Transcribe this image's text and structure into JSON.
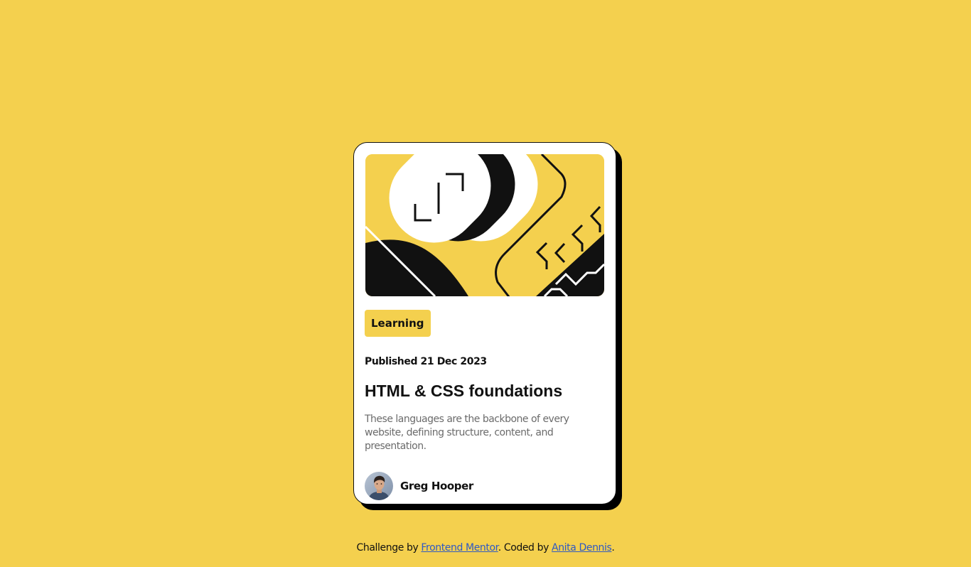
{
  "colors": {
    "background": "#F4D04E",
    "card": "#FFFFFF",
    "ink": "#111111",
    "muted": "#6B6B6B",
    "link": "#2E59C4"
  },
  "card": {
    "illustration": "abstract-yellow-black-illustration",
    "tag": "Learning",
    "published": "Published 21 Dec 2023",
    "title": "HTML & CSS foundations",
    "description": "These languages are the backbone of every website, defining structure, content, and presentation.",
    "author": {
      "avatar": "author-avatar",
      "name": "Greg Hooper"
    }
  },
  "footer": {
    "prefix": "Challenge by ",
    "link1": "Frontend Mentor",
    "middle": ". Coded by ",
    "link2": "Anita Dennis",
    "suffix": "."
  }
}
